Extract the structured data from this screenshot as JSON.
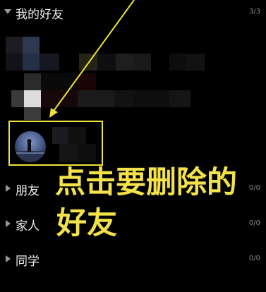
{
  "groups": [
    {
      "label": "我的好友",
      "count": "3/3",
      "expanded": true
    },
    {
      "label": "朋友",
      "count": "0/0",
      "expanded": false
    },
    {
      "label": "家人",
      "count": "0/0",
      "expanded": false
    },
    {
      "label": "同学",
      "count": "0/0",
      "expanded": false
    }
  ],
  "annotation": {
    "line1": "点击要删除的",
    "line2": "好友",
    "color": "#f3e24a"
  },
  "colors": {
    "background": "#000000",
    "highlight": "#f1e23a",
    "text": "#ececec",
    "count_text": "#8c8c8c"
  }
}
